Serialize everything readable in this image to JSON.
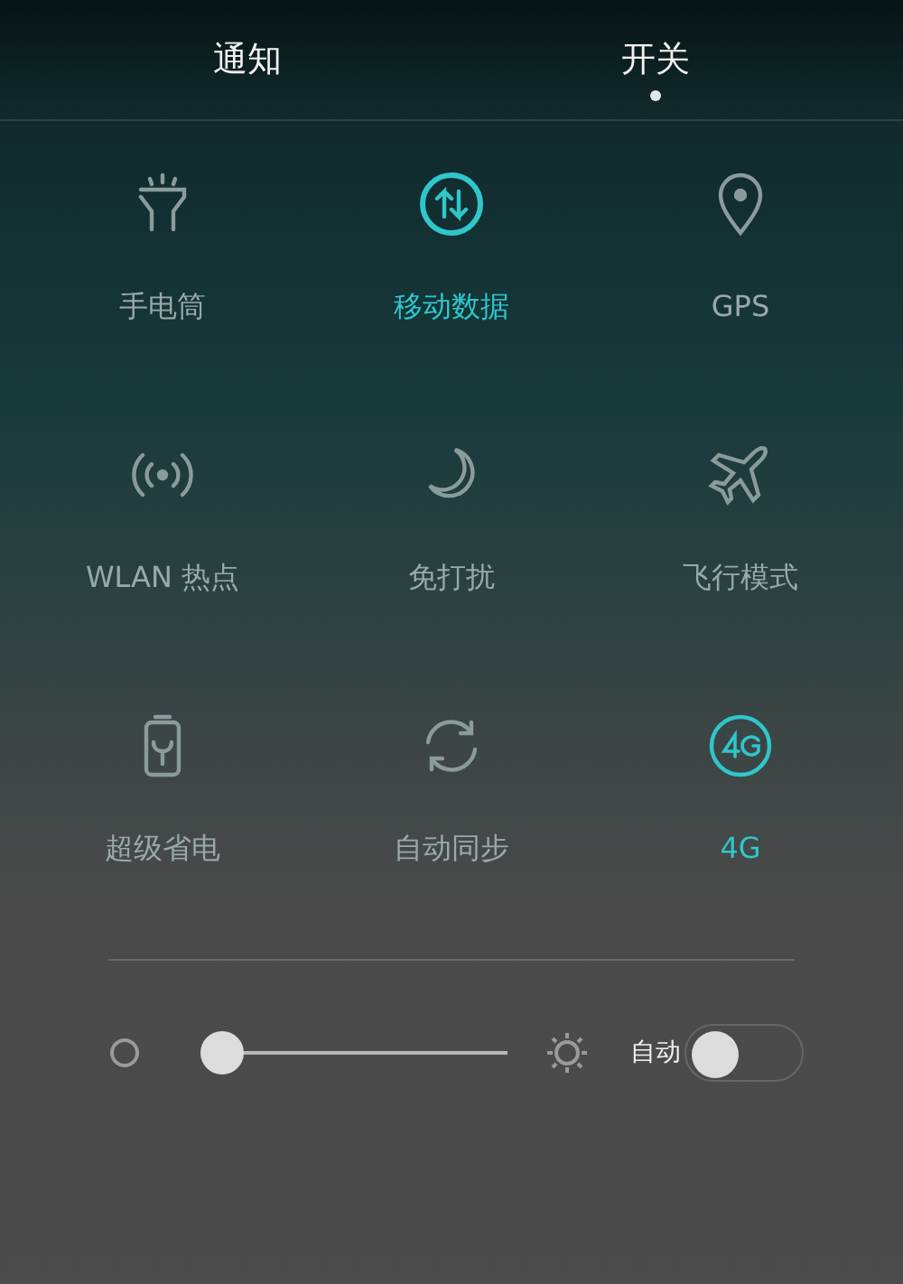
{
  "tabs": [
    {
      "label": "通知",
      "selected": false
    },
    {
      "label": "开关",
      "selected": true
    }
  ],
  "toggles": [
    {
      "kind": "flashlight",
      "label": "手电筒",
      "on": false
    },
    {
      "kind": "data",
      "label": "移动数据",
      "on": true
    },
    {
      "kind": "location",
      "label": "GPS",
      "on": false
    },
    {
      "kind": "hotspot",
      "label": "WLAN 热点",
      "on": false
    },
    {
      "kind": "moon",
      "label": "免打扰",
      "on": false
    },
    {
      "kind": "airplane",
      "label": "飞行模式",
      "on": false
    },
    {
      "kind": "battery",
      "label": "超级省电",
      "on": false
    },
    {
      "kind": "sync",
      "label": "自动同步",
      "on": false
    },
    {
      "kind": "network",
      "label": "4G",
      "on": true
    }
  ],
  "brightness": {
    "level": 0,
    "auto_label": "自动",
    "auto_on": false
  }
}
